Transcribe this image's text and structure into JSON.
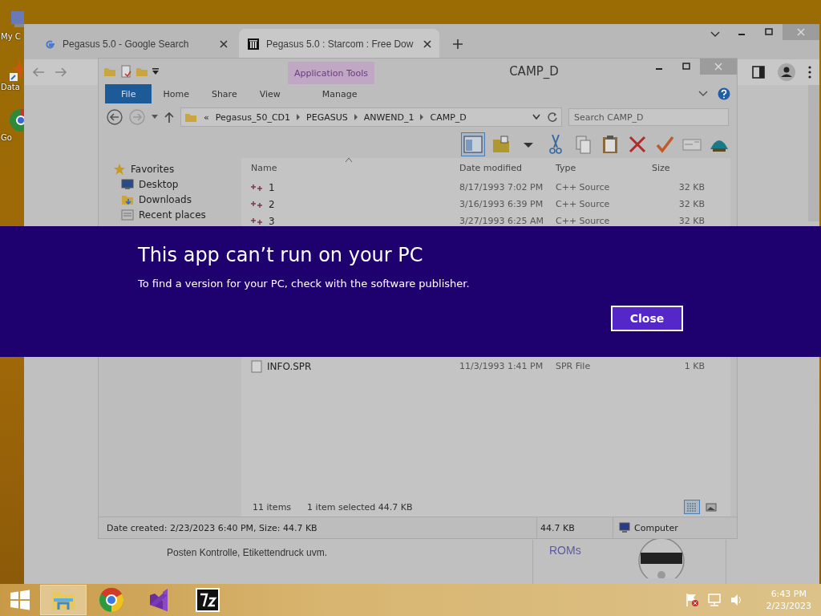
{
  "desktop_icons": [
    {
      "label": "My C",
      "kind": "computer"
    },
    {
      "label": "Data",
      "kind": "shortcut"
    },
    {
      "label": "Go",
      "kind": "chrome"
    }
  ],
  "browser": {
    "tabs": [
      {
        "title": "Pegasus 5.0 - Google Search",
        "kind": "google",
        "selected": false
      },
      {
        "title": "Pegasus 5.0 : Starcom : Free Dow",
        "kind": "archive",
        "selected": true
      }
    ],
    "page": {
      "paragraphs": [
        "Posten Kontrolle, Etikettendruck uvm."
      ],
      "side_link": "ROMs"
    }
  },
  "explorer": {
    "title": "CAMP_D",
    "context_group": "Application Tools",
    "ribbon_tabs": [
      {
        "label": "File",
        "kind": "file",
        "selected": false
      },
      {
        "label": "Home",
        "kind": "tab",
        "selected": false
      },
      {
        "label": "Share",
        "kind": "tab",
        "selected": false
      },
      {
        "label": "View",
        "kind": "tab",
        "selected": false
      },
      {
        "label": "Manage",
        "kind": "context",
        "selected": false
      }
    ],
    "address": {
      "overflow": "«",
      "crumbs": [
        "Pegasus_50_CD1",
        "PEGASUS",
        "ANWEND_1",
        "CAMP_D"
      ]
    },
    "search": {
      "placeholder": "Search CAMP_D"
    },
    "nav": [
      {
        "label": "Favorites",
        "kind": "group"
      },
      {
        "label": "Desktop",
        "kind": "desktop"
      },
      {
        "label": "Downloads",
        "kind": "downloads"
      },
      {
        "label": "Recent places",
        "kind": "recent"
      }
    ],
    "columns": [
      "Name",
      "Date modified",
      "Type",
      "Size"
    ],
    "rows_top": [
      {
        "name": "1",
        "date": "8/17/1993 7:02 PM",
        "type": "C++ Source",
        "size": "32 KB",
        "kind": "cpp"
      },
      {
        "name": "2",
        "date": "3/16/1993 6:39 PM",
        "type": "C++ Source",
        "size": "32 KB",
        "kind": "cpp"
      },
      {
        "name": "3",
        "date": "3/27/1993 6:25 AM",
        "type": "C++ Source",
        "size": "32 KB",
        "kind": "cpp"
      }
    ],
    "rows_bottom": [
      {
        "name": "INFO.SPR",
        "date": "11/3/1993 1:41 PM",
        "type": "SPR File",
        "size": "1 KB",
        "kind": "file"
      }
    ],
    "status": {
      "count": "11 items",
      "selection": "1 item selected  44.7 KB"
    },
    "views": [
      {
        "kind": "details",
        "selected": true
      },
      {
        "kind": "thumbnails",
        "selected": false
      }
    ],
    "details": {
      "summary": "Date created: 2/23/2023 6:40 PM, Size: 44.7 KB",
      "size": "44.7 KB",
      "location": "Computer"
    }
  },
  "dialog": {
    "title": "This app can’t run on your PC",
    "message": "To find a version for your PC, check with the software publisher.",
    "button": "Close"
  },
  "taskbar": {
    "apps": [
      {
        "kind": "explorer",
        "selected": true
      },
      {
        "kind": "chrome",
        "selected": false
      },
      {
        "kind": "studio",
        "selected": false
      },
      {
        "kind": "sevenzip",
        "selected": false
      }
    ],
    "time": "6:43 PM",
    "date": "2/23/2023"
  }
}
